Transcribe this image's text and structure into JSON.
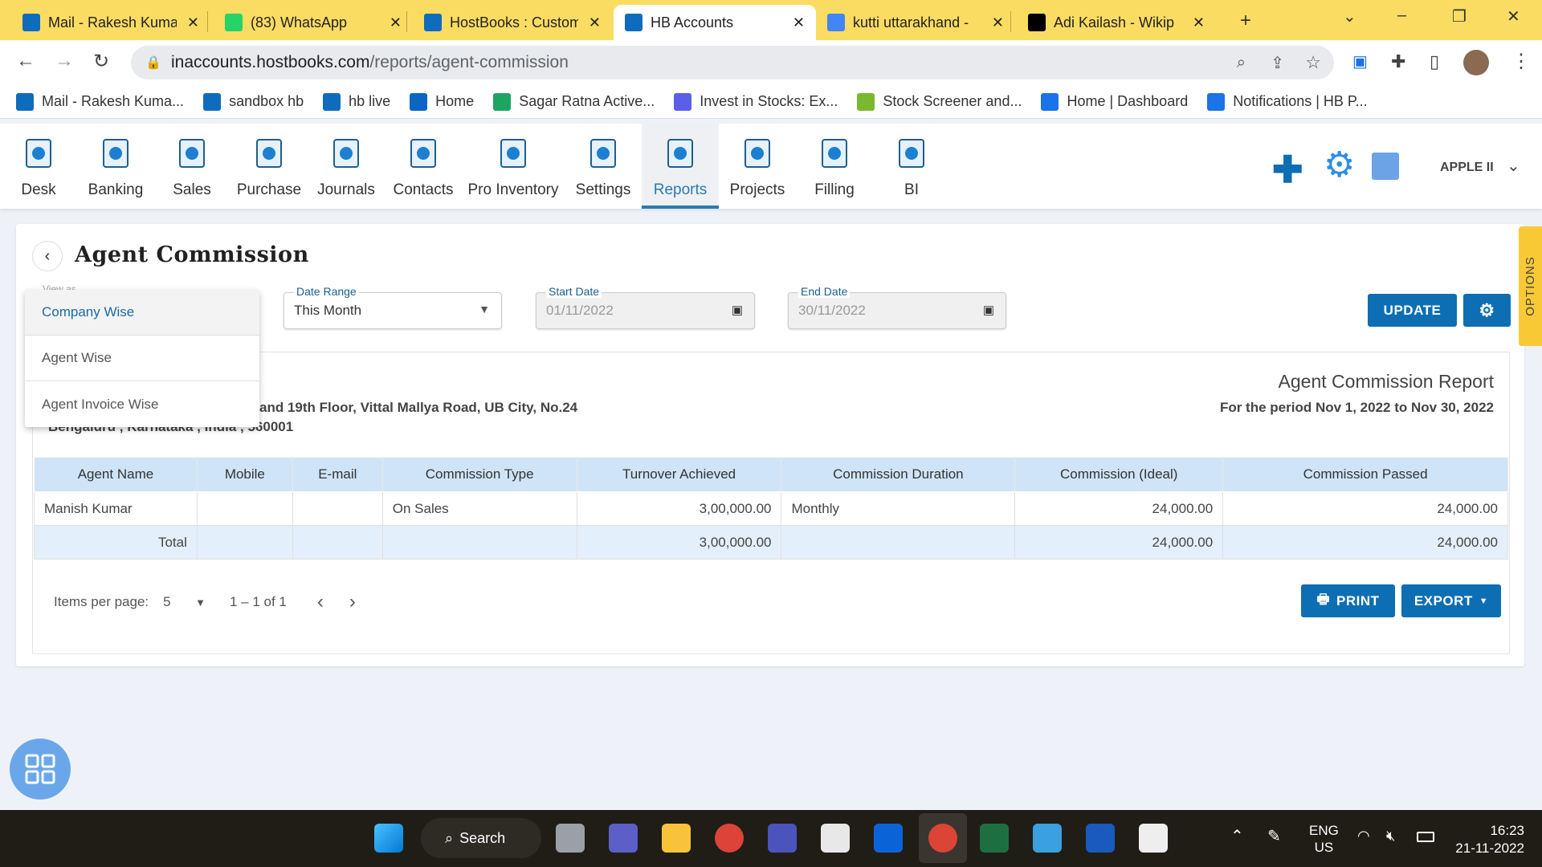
{
  "browser": {
    "tabs": [
      {
        "title": "Mail - Rakesh Kuma",
        "color": "#0f6cbd"
      },
      {
        "title": "(83) WhatsApp",
        "color": "#25d366"
      },
      {
        "title": "HostBooks : Custom",
        "color": "#0f6cbd"
      },
      {
        "title": "HB Accounts",
        "color": "#0f6cbd",
        "active": true
      },
      {
        "title": "kutti uttarakhand -",
        "color": "#4285f4"
      },
      {
        "title": "Adi Kailash - Wikip",
        "color": "#000000"
      }
    ],
    "url_host": "inaccounts.hostbooks.com",
    "url_path": "/reports/agent-commission",
    "bookmarks": [
      {
        "label": "Mail - Rakesh Kuma...",
        "color": "#0f6cbd"
      },
      {
        "label": "sandbox hb",
        "color": "#0f6cbd"
      },
      {
        "label": "hb live",
        "color": "#0f6cbd"
      },
      {
        "label": "Home",
        "color": "#0a66c2"
      },
      {
        "label": "Sagar Ratna Active...",
        "color": "#1da462"
      },
      {
        "label": "Invest in Stocks: Ex...",
        "color": "#5b5fe8"
      },
      {
        "label": "Stock Screener and...",
        "color": "#7cb82f"
      },
      {
        "label": "Home | Dashboard",
        "color": "#1a73e8"
      },
      {
        "label": "Notifications | HB P...",
        "color": "#1a73e8"
      }
    ]
  },
  "nav": {
    "items": [
      "Desk",
      "Banking",
      "Sales",
      "Purchase",
      "Journals",
      "Contacts",
      "Pro Inventory",
      "Settings",
      "Reports",
      "Projects",
      "Filling",
      "BI"
    ],
    "active": "Reports",
    "company": "APPLE II",
    "accent": "#2a7ab0"
  },
  "page": {
    "title": "Agent Commission",
    "view_as_label": "View as",
    "view_as_options": [
      "Company Wise",
      "Agent Wise",
      "Agent Invoice Wise"
    ],
    "view_as_selected": "Company Wise",
    "date_range_label": "Date Range",
    "date_range_value": "This Month",
    "start_date_label": "Start Date",
    "start_date_value": "01/11/2022",
    "end_date_label": "End Date",
    "end_date_value": "30/11/2022",
    "update_label": "UPDATE",
    "options_label": "OPTIONS"
  },
  "report": {
    "title": "Agent Commission Report",
    "period": "For the period Nov 1, 2022 to Nov 30, 2022",
    "address_line1": "and 19th Floor, Vittal Mallya Road, UB City, No.24",
    "address_line2": "Bengaluru , Karnataka , India , 560001",
    "columns": [
      "Agent Name",
      "Mobile",
      "E-mail",
      "Commission Type",
      "Turnover Achieved",
      "Commission Duration",
      "Commission (Ideal)",
      "Commission Passed"
    ],
    "rows": [
      [
        "Manish Kumar",
        "",
        "",
        "On Sales",
        "3,00,000.00",
        "Monthly",
        "24,000.00",
        "24,000.00"
      ]
    ],
    "total": [
      "Total",
      "",
      "",
      "",
      "3,00,000.00",
      "",
      "24,000.00",
      "24,000.00"
    ]
  },
  "pagination": {
    "items_per_page_label": "Items per page:",
    "items_per_page": "5",
    "range": "1 – 1 of 1"
  },
  "actions": {
    "print": "PRINT",
    "export": "EXPORT"
  },
  "taskbar": {
    "search": "Search",
    "lang1": "ENG",
    "lang2": "US",
    "time": "16:23",
    "date": "21-11-2022"
  }
}
